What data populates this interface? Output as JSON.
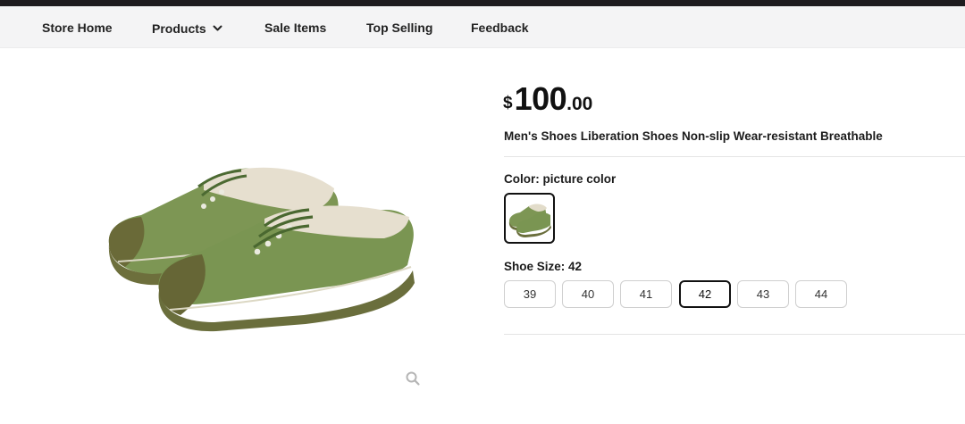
{
  "nav": {
    "items": [
      {
        "label": "Store Home"
      },
      {
        "label": "Products",
        "has_dropdown": true
      },
      {
        "label": "Sale Items"
      },
      {
        "label": "Top Selling"
      },
      {
        "label": "Feedback"
      }
    ]
  },
  "product": {
    "price": {
      "currency": "$",
      "integer": "100",
      "decimal": ".00"
    },
    "title": "Men's Shoes Liberation Shoes Non-slip Wear-resistant Breathable",
    "image_icon": "green-canvas-shoes-image",
    "zoom_icon": "search-icon",
    "color": {
      "label": "Color: picture color",
      "selected_index": 0
    },
    "size": {
      "label": "Shoe Size: 42",
      "options": [
        "39",
        "40",
        "41",
        "42",
        "43",
        "44"
      ],
      "selected": "42"
    }
  },
  "colors": {
    "topbar": "#1e1c1f",
    "nav_bg": "#f4f4f5",
    "shoe_green": "#7a9552",
    "sole": "#6a6e3c",
    "selected_border": "#111111"
  }
}
